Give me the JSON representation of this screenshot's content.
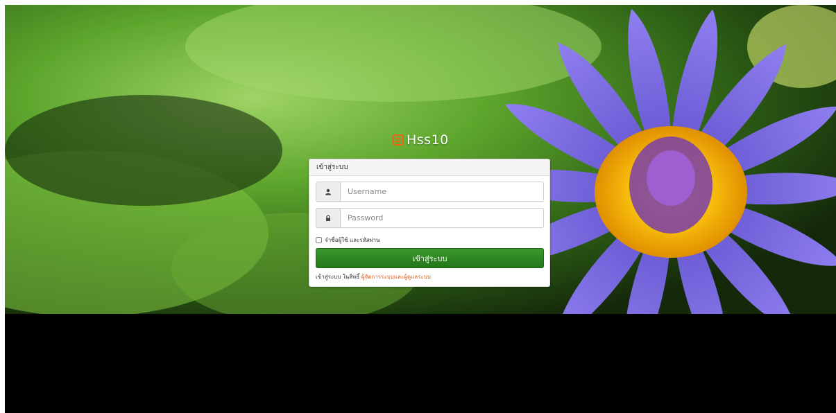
{
  "brand": {
    "logo_icon": "grid-logo-icon",
    "name": "Hss10"
  },
  "login": {
    "heading": "เข้าสู่ระบบ",
    "username_placeholder": "Username",
    "username_icon": "user-icon",
    "password_placeholder": "Password",
    "password_icon": "lock-icon",
    "remember_label": "จำชื่อผู้ใช้ และรหัสผ่าน",
    "remember_checked": false,
    "submit_label": "เข้าสู่ระบบ",
    "footer_text": "เข้าสู่ระบบ ในสิทธิ์",
    "footer_link": "ผู้จัดการระบบและผู้ดูแลระบบ"
  },
  "colors": {
    "accent_green": "#2e8b22",
    "link_orange": "#e05a1a",
    "brand_orange": "#e8651a"
  }
}
